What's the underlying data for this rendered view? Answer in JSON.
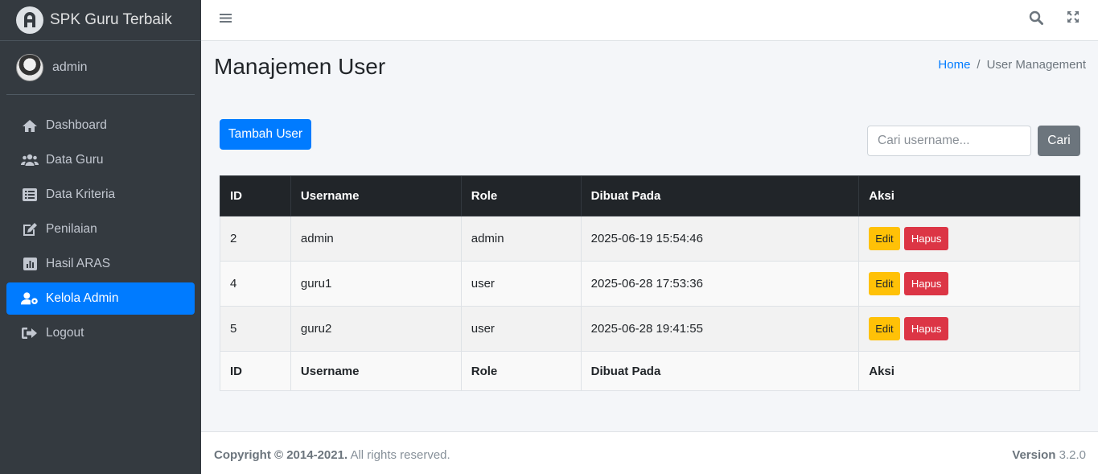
{
  "brand": {
    "name": "SPK Guru Terbaik",
    "logo_icon": "letter-a-logo-icon"
  },
  "user": {
    "name": "admin"
  },
  "sidebar": {
    "items": [
      {
        "label": "Dashboard",
        "icon": "home-icon"
      },
      {
        "label": "Data Guru",
        "icon": "users-icon"
      },
      {
        "label": "Data Kriteria",
        "icon": "list-icon"
      },
      {
        "label": "Penilaian",
        "icon": "edit-icon"
      },
      {
        "label": "Hasil ARAS",
        "icon": "chart-icon"
      },
      {
        "label": "Kelola Admin",
        "icon": "user-cog-icon",
        "active": true
      },
      {
        "label": "Logout",
        "icon": "sign-out-icon"
      }
    ]
  },
  "header": {
    "title": "Manajemen User"
  },
  "breadcrumb": {
    "home": "Home",
    "separator": "/",
    "current": "User Management"
  },
  "actions": {
    "add_label": "Tambah User",
    "search_placeholder": "Cari username...",
    "search_button": "Cari"
  },
  "table": {
    "columns": [
      "ID",
      "Username",
      "Role",
      "Dibuat Pada",
      "Aksi"
    ],
    "edit_label": "Edit",
    "delete_label": "Hapus",
    "rows": [
      {
        "id": "2",
        "username": "admin",
        "role": "admin",
        "created": "2025-06-19 15:54:46"
      },
      {
        "id": "4",
        "username": "guru1",
        "role": "user",
        "created": "2025-06-28 17:53:36"
      },
      {
        "id": "5",
        "username": "guru2",
        "role": "user",
        "created": "2025-06-28 19:41:55"
      }
    ]
  },
  "footer": {
    "copyright_bold": "Copyright © 2014-2021.",
    "copyright_rest": " All rights reserved.",
    "version_label": "Version",
    "version_number": " 3.2.0"
  },
  "colors": {
    "primary": "#007bff",
    "sidebar_bg": "#343a40",
    "warning": "#ffc107",
    "danger": "#dc3545",
    "secondary": "#6c757d"
  }
}
